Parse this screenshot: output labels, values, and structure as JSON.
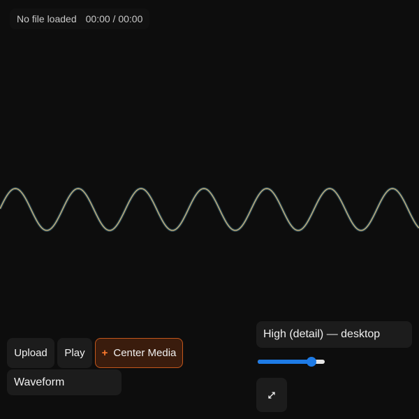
{
  "status": {
    "file_label": "No file loaded",
    "time": "00:00 / 00:00"
  },
  "controls": {
    "upload_label": "Upload",
    "play_label": "Play",
    "center_media_label": "Center Media",
    "center_media_icon": "plus-icon",
    "mode_value": "Waveform",
    "quality_value": "High (detail) — desktop",
    "slider_value": 0.85,
    "fullscreen_icon": "expand-icon"
  },
  "colors": {
    "background": "#0d0d0d",
    "wave_stroke": "#c9b27c",
    "wave_glow": "#4fa3c7",
    "accent_orange": "#ff7a2e",
    "slider_blue": "#1e7be6"
  }
}
